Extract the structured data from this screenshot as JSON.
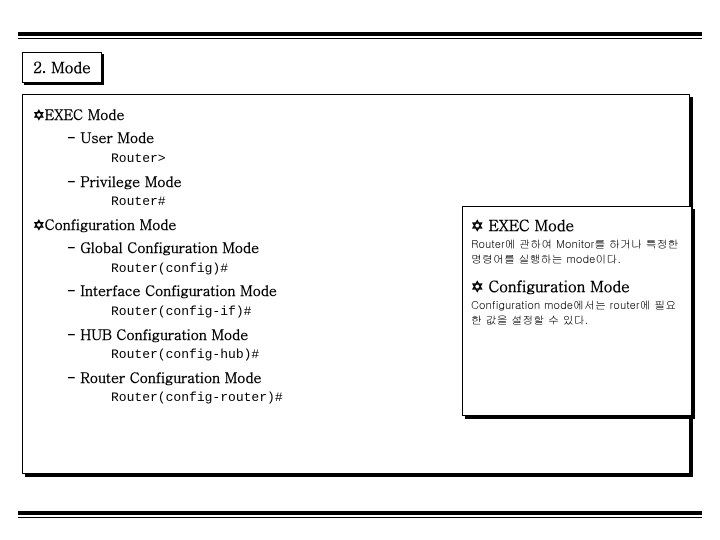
{
  "title": "2. Mode",
  "main": {
    "sec1": {
      "heading": "EXEC Mode",
      "item1": {
        "label": "- User Mode",
        "prompt": "Router>"
      },
      "item2": {
        "label": "-  Privilege Mode",
        "prompt": "Router#"
      }
    },
    "sec2": {
      "heading": "Configuration Mode",
      "item1": {
        "label": "- Global Configuration Mode",
        "prompt": "Router(config)#"
      },
      "item2": {
        "label": "- Interface Configuration Mode",
        "prompt": "Router(config-if)#"
      },
      "item3": {
        "label": "- HUB Configuration Mode",
        "prompt": "Router(config-hub)#"
      },
      "item4": {
        "label": "- Router Configuration Mode",
        "prompt": "Router(config-router)#"
      }
    }
  },
  "side": {
    "h1": "EXEC Mode",
    "t1": "Router에 관하여 Monitor를 하거나 특정한 명령어를 실행하는 mode이다.",
    "h2": "Configuration Mode",
    "t2": "Configuration mode에서는 router에 필요한 값을 설정할 수 있다."
  },
  "glyph": {
    "star": "✡"
  }
}
